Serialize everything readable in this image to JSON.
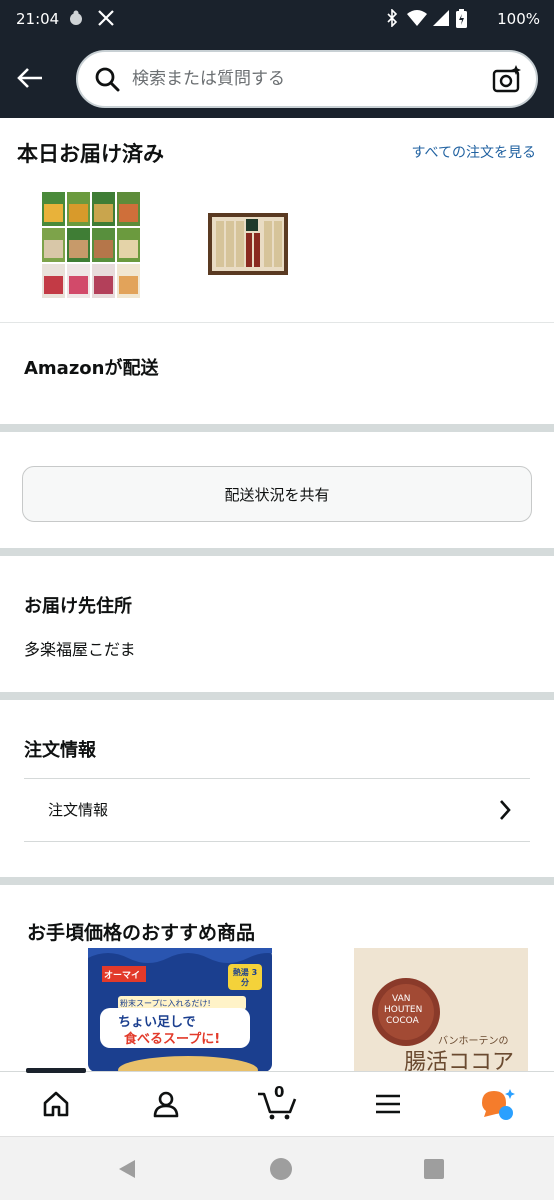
{
  "status_bar": {
    "time": "21:04",
    "battery": "100%",
    "icons": [
      "app-notification-icon",
      "x-logo-icon",
      "bluetooth-icon",
      "wifi-icon",
      "cell-signal-icon",
      "battery-icon"
    ]
  },
  "header": {
    "search_placeholder": "検索または質問する",
    "icons": [
      "back-arrow-icon",
      "search-icon",
      "camera-search-icon"
    ]
  },
  "delivered": {
    "title": "本日お届け済み",
    "see_all": "すべての注文を見る"
  },
  "shipper": {
    "title": "Amazonが配送"
  },
  "share": {
    "label": "配送状況を共有"
  },
  "address": {
    "title": "お届け先住所",
    "name": "多楽福屋こだま"
  },
  "order_info": {
    "title": "注文情報",
    "row_label": "注文情報"
  },
  "recommendations": {
    "title": "お手頃価格のおすすめ商品",
    "items": [
      {
        "brand": "オーマイ",
        "badge": "熱湯 3分",
        "tagline": "粉末スープに入れるだけ!",
        "headline_1": "ちょい足しで",
        "headline_2": "食べるスープに!"
      },
      {
        "brand_1": "VAN",
        "brand_2": "HOUTEN",
        "brand_3": "COCOA",
        "text": "バンホーテンの",
        "headline": "腸活ココア"
      }
    ]
  },
  "bottom_nav": {
    "cart_count": "0",
    "icons": [
      "home-icon",
      "account-icon",
      "cart-icon",
      "menu-icon",
      "rufus-icon"
    ]
  },
  "colors": {
    "header_bg": "#1a222c",
    "link": "#2162a1",
    "divider": "#d5dbdb",
    "rufus_orange": "#f57c2b",
    "rufus_blue": "#2aa0ff"
  }
}
